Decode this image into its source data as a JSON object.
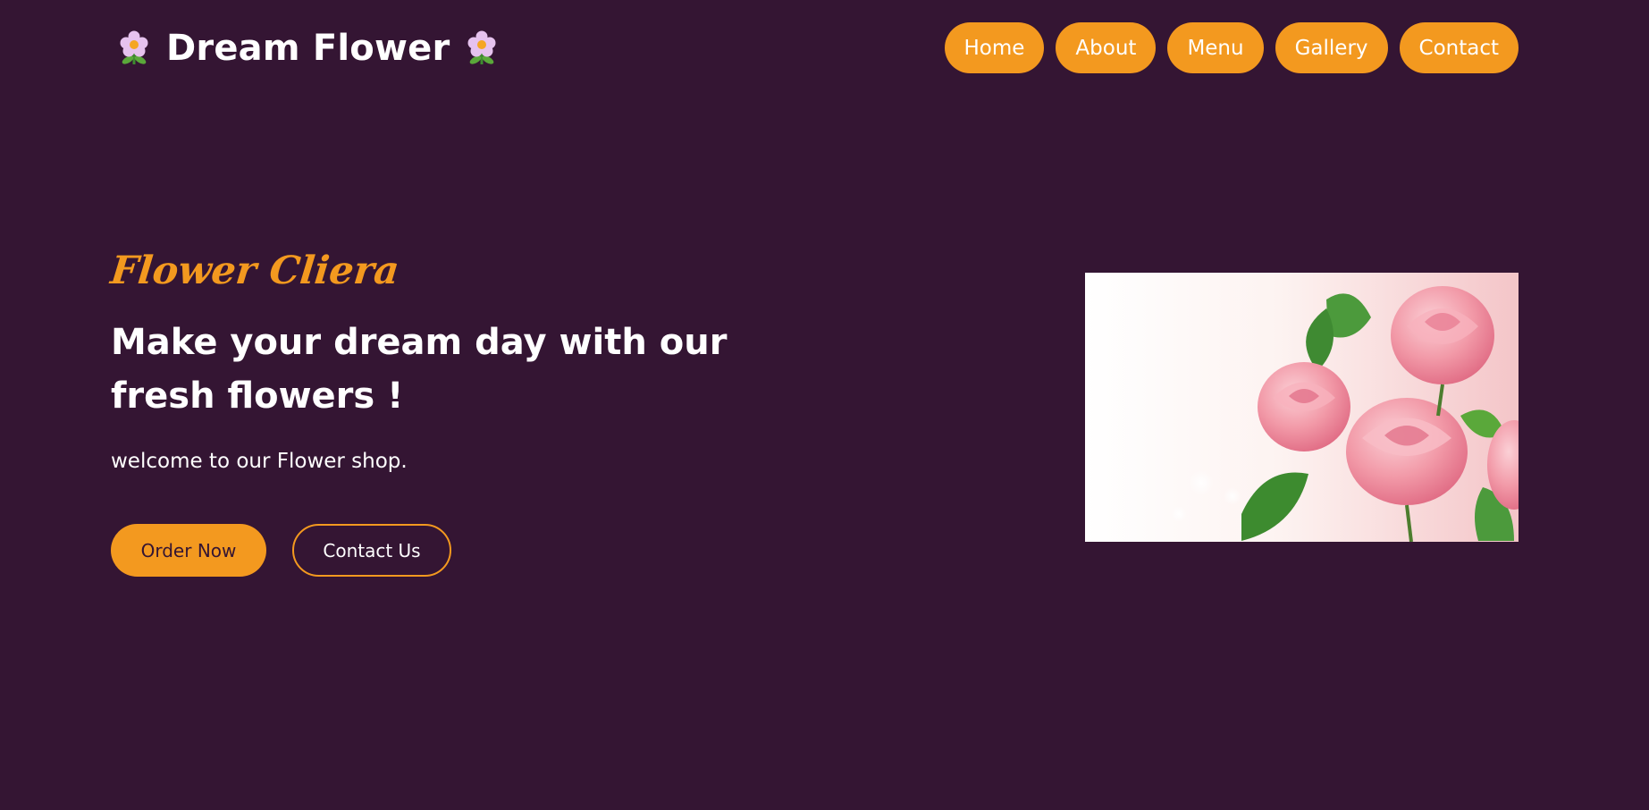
{
  "header": {
    "logo_text": "Dream Flower",
    "logo_icon_left": "flower-icon",
    "logo_icon_right": "flower-icon",
    "nav": [
      {
        "label": "Home"
      },
      {
        "label": "About"
      },
      {
        "label": "Menu"
      },
      {
        "label": "Gallery"
      },
      {
        "label": "Contact"
      }
    ]
  },
  "hero": {
    "script_title": "Flower Cliera",
    "heading": "Make your dream day with our fresh flowers !",
    "subtitle": "welcome to our Flower shop.",
    "primary_button": "Order Now",
    "secondary_button": "Contact Us",
    "image_subject": "pink roses"
  },
  "colors": {
    "background": "#341533",
    "accent": "#f3991f",
    "text": "#ffffff"
  }
}
